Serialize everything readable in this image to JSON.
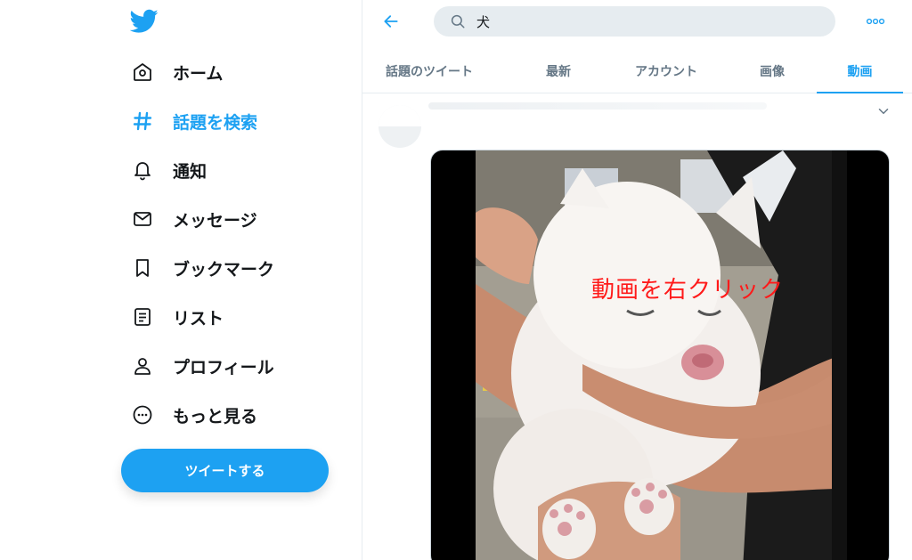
{
  "sidebar": {
    "logo": "twitter-bird-icon",
    "items": [
      {
        "label": "ホーム",
        "icon": "home-icon",
        "active": false
      },
      {
        "label": "話題を検索",
        "icon": "hashtag-icon",
        "active": true
      },
      {
        "label": "通知",
        "icon": "bell-icon",
        "active": false
      },
      {
        "label": "メッセージ",
        "icon": "envelope-icon",
        "active": false
      },
      {
        "label": "ブックマーク",
        "icon": "bookmark-icon",
        "active": false
      },
      {
        "label": "リスト",
        "icon": "list-icon",
        "active": false
      },
      {
        "label": "プロフィール",
        "icon": "person-icon",
        "active": false
      },
      {
        "label": "もっと見る",
        "icon": "more-circle-icon",
        "active": false
      }
    ],
    "tweet_button_label": "ツイートする"
  },
  "main": {
    "search": {
      "value": "犬"
    },
    "tabs": [
      {
        "label": "話題のツイート",
        "active": false
      },
      {
        "label": "最新",
        "active": false
      },
      {
        "label": "アカウント",
        "active": false
      },
      {
        "label": "画像",
        "active": false
      },
      {
        "label": "動画",
        "active": true
      }
    ],
    "video": {
      "overlay_text": "動画を右クリック"
    }
  },
  "colors": {
    "accent": "#1da1f2",
    "text": "#14171a",
    "muted": "#657786",
    "overlay_text": "#ff1a1a"
  }
}
